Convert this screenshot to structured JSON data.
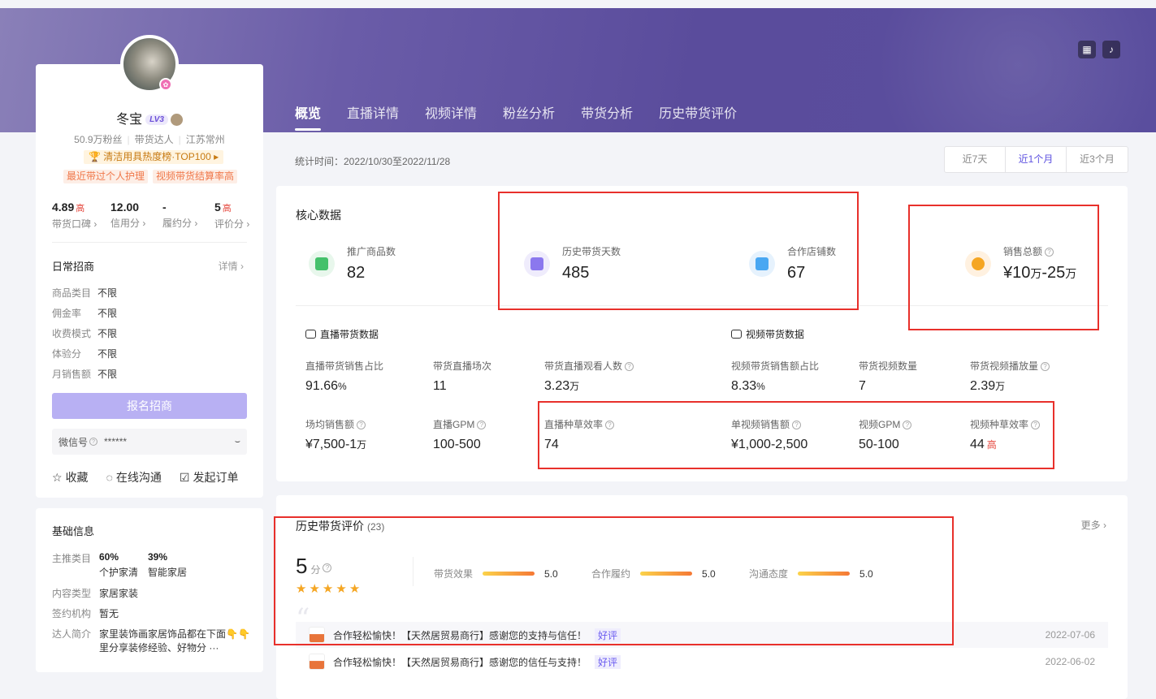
{
  "header": {
    "tabs": [
      {
        "label": "概览"
      },
      {
        "label": "直播详情"
      },
      {
        "label": "视频详情"
      },
      {
        "label": "粉丝分析"
      },
      {
        "label": "带货分析"
      },
      {
        "label": "历史带货评价"
      }
    ],
    "icons": [
      "qr-code-icon",
      "douyin-icon"
    ]
  },
  "profile": {
    "name": "冬宝",
    "level": "LV3",
    "fans": "50.9万粉丝",
    "role": "带货达人",
    "location": "江苏常州",
    "rank": "清洁用具热度榜·TOP100",
    "tags": [
      "最近带过个人护理",
      "视频带货结算率高"
    ],
    "scores": [
      {
        "value": "4.89",
        "flag": "高",
        "label": "带货口碑"
      },
      {
        "value": "12.00",
        "flag": "",
        "label": "信用分"
      },
      {
        "value": "-",
        "flag": "",
        "label": "履约分"
      },
      {
        "value": "5",
        "flag": "高",
        "label": "评价分"
      }
    ]
  },
  "merchant": {
    "title": "日常招商",
    "more": "详情",
    "rows": [
      {
        "k": "商品类目",
        "v": "不限"
      },
      {
        "k": "佣金率",
        "v": "不限"
      },
      {
        "k": "收费模式",
        "v": "不限"
      },
      {
        "k": "体验分",
        "v": "不限"
      },
      {
        "k": "月销售额",
        "v": "不限"
      }
    ],
    "apply_btn": "报名招商",
    "wechat_label": "微信号",
    "wechat_value": "******",
    "actions": [
      "收藏",
      "在线沟通",
      "发起订单"
    ]
  },
  "basic": {
    "title": "基础信息",
    "main_category_label": "主推类目",
    "cat1_pct": "60%",
    "cat1_name": "个护家清",
    "cat2_pct": "39%",
    "cat2_name": "智能家居",
    "content_type_label": "内容类型",
    "content_type": "家居家装",
    "agency_label": "签约机构",
    "agency": "暂无",
    "intro_label": "达人简介",
    "intro_line1": "家里装饰画家居饰品都在下面👇👇",
    "intro_line2": "里分享装修经验、好物分 ···"
  },
  "stats": {
    "time": "统计时间：2022/10/30至2022/11/28",
    "ranges": [
      "近7天",
      "近1个月",
      "近3个月"
    ],
    "active_range": 1
  },
  "core": {
    "title": "核心数据",
    "metrics": [
      {
        "label": "推广商品数",
        "value": "82"
      },
      {
        "label": "历史带货天数",
        "value": "485"
      },
      {
        "label": "合作店铺数",
        "value": "67"
      },
      {
        "label": "销售总额",
        "value_prefix": "¥10",
        "unit1": "万",
        "value_mid": "-25",
        "unit2": "万"
      }
    ],
    "live_title": "直播带货数据",
    "video_title": "视频带货数据",
    "live": [
      {
        "label": "直播带货销售占比",
        "value": "91.66",
        "unit": "%"
      },
      {
        "label": "带货直播场次",
        "value": "11",
        "unit": ""
      },
      {
        "label": "带货直播观看人数",
        "value": "3.23",
        "unit": "万"
      },
      {
        "label": "场均销售额",
        "value": "¥7,500-1",
        "unit": "万"
      },
      {
        "label": "直播GPM",
        "value": "100-500",
        "unit": ""
      },
      {
        "label": "直播种草效率",
        "value": "74",
        "unit": ""
      }
    ],
    "video": [
      {
        "label": "视频带货销售额占比",
        "value": "8.33",
        "unit": "%"
      },
      {
        "label": "带货视频数量",
        "value": "7",
        "unit": ""
      },
      {
        "label": "带货视频播放量",
        "value": "2.39",
        "unit": "万"
      },
      {
        "label": "单视频销售额",
        "value": "¥1,000-2,500",
        "unit": ""
      },
      {
        "label": "视频GPM",
        "value": "50-100",
        "unit": ""
      },
      {
        "label": "视频种草效率",
        "value": "44",
        "unit": "",
        "flag": "高"
      }
    ]
  },
  "reviews": {
    "title": "历史带货评价",
    "count": "(23)",
    "more": "更多",
    "score": "5",
    "score_unit": "分",
    "bars": [
      {
        "label": "带货效果",
        "value": "5.0",
        "level": 1.0
      },
      {
        "label": "合作履约",
        "value": "5.0",
        "level": 1.0
      },
      {
        "label": "沟通态度",
        "value": "5.0",
        "level": 1.0
      }
    ],
    "items": [
      {
        "text": "合作轻松愉快！【天然居贸易商行】感谢您的支持与信任！",
        "badge": "好评",
        "date": "2022-07-06"
      },
      {
        "text": "合作轻松愉快！【天然居贸易商行】感谢您的信任与支持！",
        "badge": "好评",
        "date": "2022-06-02"
      }
    ]
  },
  "colors": {
    "accent": "#5d51e0",
    "highlight": "#e8302b",
    "star": "#f5a623"
  }
}
